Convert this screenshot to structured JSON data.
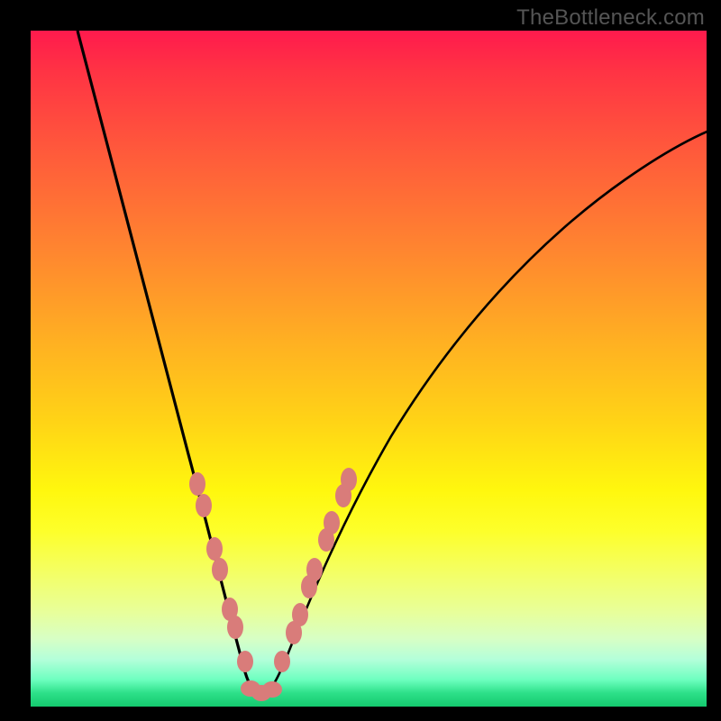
{
  "watermark": "TheBottleneck.com",
  "colors": {
    "frame": "#000000",
    "curve": "#000000",
    "bead": "#d97c7a",
    "gradient_top": "#ff1a4d",
    "gradient_bottom": "#14c96e"
  },
  "chart_data": {
    "type": "line",
    "title": "",
    "xlabel": "",
    "ylabel": "",
    "xlim": [
      0,
      100
    ],
    "ylim": [
      0,
      100
    ],
    "note": "Axes unlabeled; values estimated from pixel positions on a 0–100 normalized scale. Curve minimum at roughly x≈33, y≈2. Salmon beads mark highlighted data points along both branches near the trough.",
    "series": [
      {
        "name": "left-branch",
        "x": [
          7,
          10,
          13,
          16,
          19,
          22,
          24,
          26,
          28,
          30,
          32,
          33
        ],
        "y": [
          100,
          88,
          76,
          64,
          53,
          43,
          35,
          27,
          20,
          13,
          7,
          2
        ]
      },
      {
        "name": "right-branch",
        "x": [
          33,
          35,
          37,
          39,
          41,
          44,
          48,
          53,
          60,
          68,
          77,
          87,
          100
        ],
        "y": [
          2,
          5,
          9,
          14,
          19,
          26,
          35,
          44,
          54,
          63,
          71,
          78,
          85
        ]
      }
    ],
    "beads": [
      {
        "branch": "left",
        "x": 24.5,
        "y": 33
      },
      {
        "branch": "left",
        "x": 25.5,
        "y": 30
      },
      {
        "branch": "left",
        "x": 27.2,
        "y": 23
      },
      {
        "branch": "left",
        "x": 28.0,
        "y": 20
      },
      {
        "branch": "left",
        "x": 29.5,
        "y": 14
      },
      {
        "branch": "left",
        "x": 30.2,
        "y": 11.5
      },
      {
        "branch": "left",
        "x": 31.7,
        "y": 6.5
      },
      {
        "branch": "flat",
        "x": 32.5,
        "y": 2.2
      },
      {
        "branch": "flat",
        "x": 34.0,
        "y": 2.0
      },
      {
        "branch": "flat",
        "x": 35.5,
        "y": 2.3
      },
      {
        "branch": "right",
        "x": 37.0,
        "y": 6.8
      },
      {
        "branch": "right",
        "x": 38.8,
        "y": 11
      },
      {
        "branch": "right",
        "x": 39.7,
        "y": 14
      },
      {
        "branch": "right",
        "x": 41.0,
        "y": 18
      },
      {
        "branch": "right",
        "x": 41.8,
        "y": 20.5
      },
      {
        "branch": "right",
        "x": 43.5,
        "y": 25
      },
      {
        "branch": "right",
        "x": 44.3,
        "y": 27.5
      },
      {
        "branch": "right",
        "x": 46.0,
        "y": 31.5
      },
      {
        "branch": "right",
        "x": 46.8,
        "y": 34
      }
    ]
  }
}
